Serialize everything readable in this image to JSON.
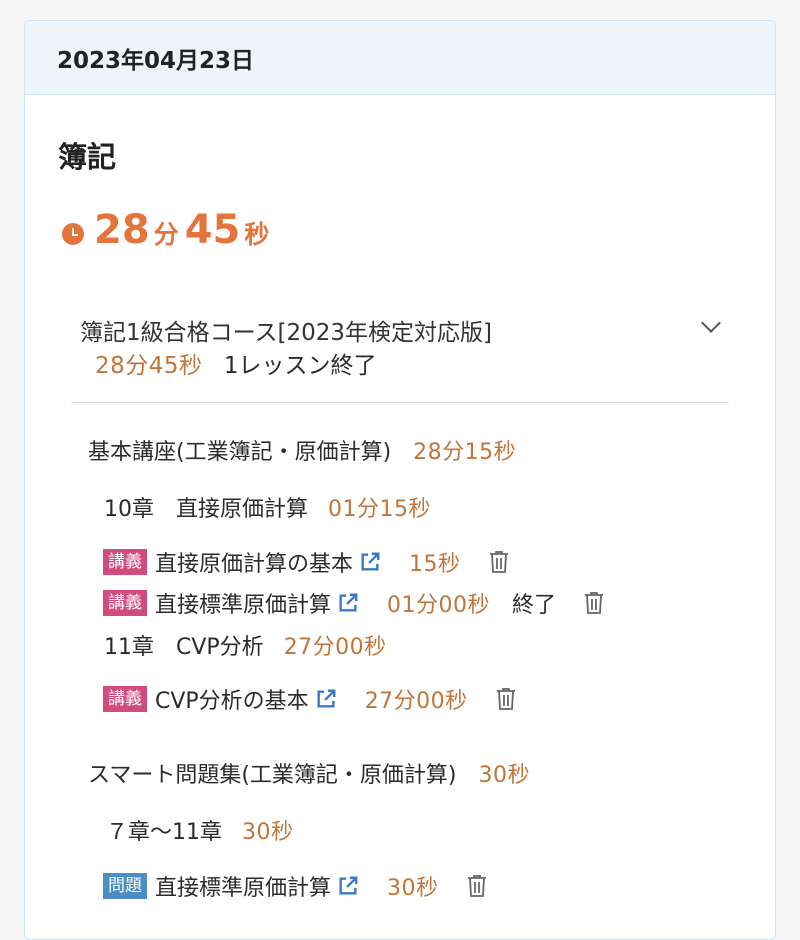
{
  "date": "2023年04月23日",
  "subject": "簿記",
  "total_time": {
    "min": "28",
    "min_unit": "分",
    "sec": "45",
    "sec_unit": "秒"
  },
  "course": {
    "title": "簿記1級合格コース[2023年検定対応版]",
    "time": "28分45秒",
    "status": "1レッスン終了"
  },
  "sections": [
    {
      "title": "基本講座(工業簿記・原価計算)",
      "time": "28分15秒",
      "chapters": [
        {
          "title": "10章　直接原価計算",
          "time": "01分15秒",
          "items": [
            {
              "badge": "講義",
              "title": "直接原価計算の基本",
              "time": "15秒",
              "status": ""
            },
            {
              "badge": "講義",
              "title": "直接標準原価計算",
              "time": "01分00秒",
              "status": "終了"
            }
          ]
        },
        {
          "title": "11章　CVP分析",
          "time": "27分00秒",
          "items": [
            {
              "badge": "講義",
              "title": "CVP分析の基本",
              "time": "27分00秒",
              "status": ""
            }
          ]
        }
      ]
    },
    {
      "title": "スマート問題集(工業簿記・原価計算)",
      "time": "30秒",
      "chapters": [
        {
          "title": "７章〜11章",
          "time": "30秒",
          "items": [
            {
              "badge": "問題",
              "title": "直接標準原価計算",
              "time": "30秒",
              "status": ""
            }
          ]
        }
      ]
    }
  ],
  "colors": {
    "accent": "#e4743a",
    "time_text": "#c0763a",
    "lecture_badge": "#d24b7f",
    "question_badge": "#4a8ec5",
    "link_icon": "#3a78c9"
  },
  "icons": [
    "clock-icon",
    "chevron-down-icon",
    "external-link-icon",
    "trash-icon"
  ]
}
